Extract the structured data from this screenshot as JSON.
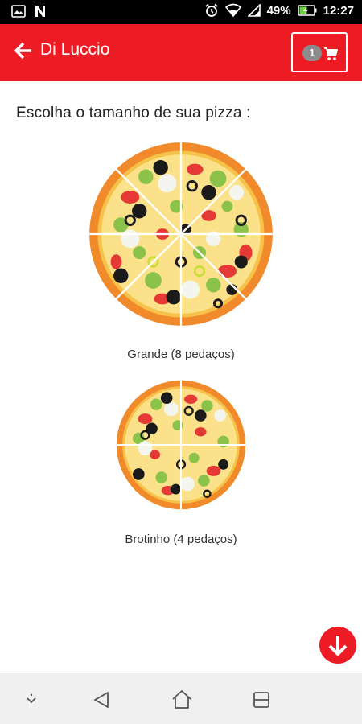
{
  "status_bar": {
    "left_icons": [
      "image-icon",
      "n-icon"
    ],
    "right_icons": [
      "alarm-icon",
      "wifi-icon",
      "signal-icon",
      "battery-icon"
    ],
    "battery": "49%",
    "time": "12:27"
  },
  "app_bar": {
    "title": "Di Luccio",
    "cart_count": "1",
    "back_icon": "arrow-left-icon",
    "cart_icon": "cart-icon",
    "color": "#ed1c24"
  },
  "main": {
    "prompt": "Escolha o tamanho de sua pizza :",
    "options": [
      {
        "label": "Grande (8 pedaços)"
      },
      {
        "label": "Brotinho (4 pedaços)"
      }
    ]
  },
  "fab": {
    "icon": "arrow-down-icon"
  },
  "nav_bar": {
    "buttons": [
      "hide-keyboard-icon",
      "back-triangle-icon",
      "home-icon",
      "recents-icon"
    ]
  }
}
